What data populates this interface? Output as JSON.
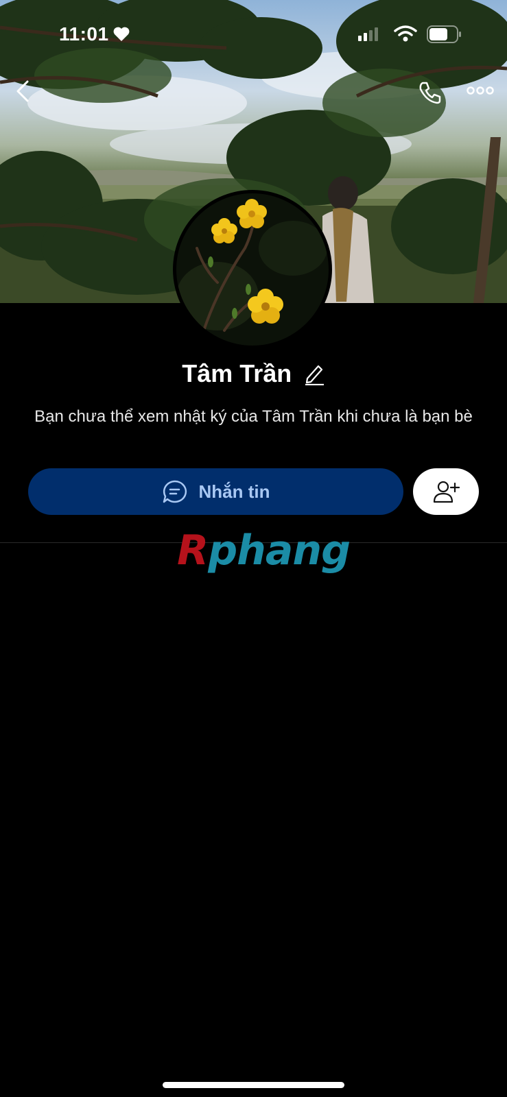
{
  "status_bar": {
    "time": "11:01"
  },
  "profile": {
    "name": "Tâm Trần",
    "notice": "Bạn chưa thể xem nhật ký của Tâm Trần khi chưa là bạn bè"
  },
  "actions": {
    "message_label": "Nhắn tin"
  },
  "watermark": {
    "first": "R",
    "rest": "phang"
  },
  "icons": {
    "back": "back-icon",
    "phone": "phone-icon",
    "more": "more-icon",
    "edit": "pencil-icon",
    "message": "chat-bubble-icon",
    "add_friend": "add-person-icon"
  },
  "colors": {
    "message_button_bg": "#012e6c",
    "message_button_text": "#a9c8f3",
    "background": "#000000"
  }
}
